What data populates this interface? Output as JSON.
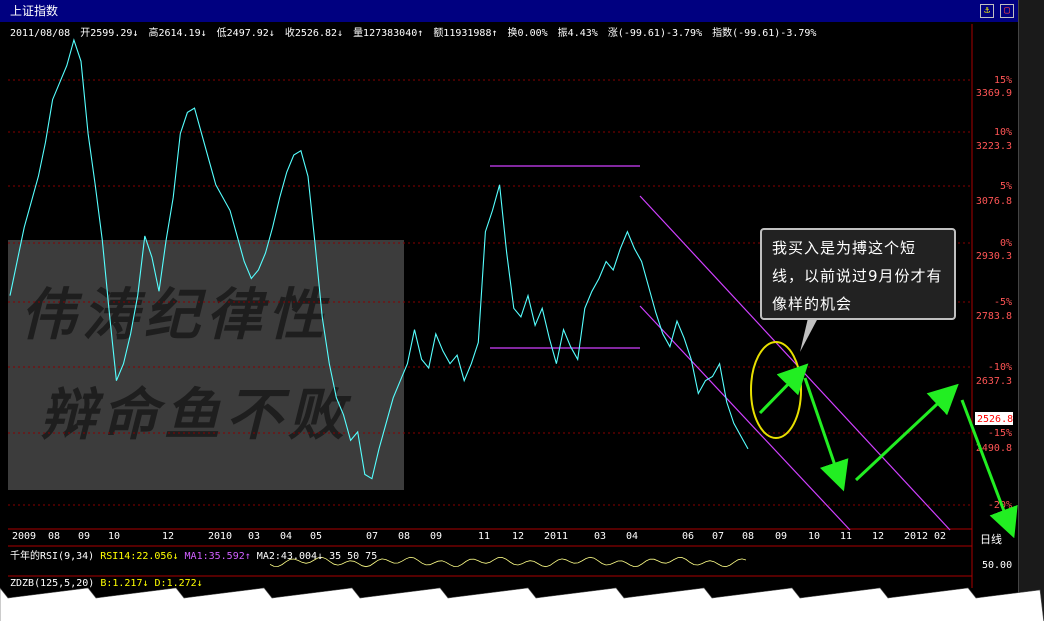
{
  "window": {
    "title": "上证指数"
  },
  "info_bar": {
    "date": "2011/08/08",
    "open": "开2599.29↓",
    "high": "高2614.19↓",
    "low": "低2497.92↓",
    "close": "收2526.82↓",
    "volume": "量127383040↑",
    "amount": "额11931988↑",
    "turnover": "换0.00%",
    "amplitude": "振4.43%",
    "change": "涨(-99.61)-3.79%",
    "index": "指数(-99.61)-3.79%"
  },
  "y_axis": {
    "pct_labels": [
      "15%",
      "10%",
      "5%",
      "0%",
      "-5%",
      "-10%",
      "-15%",
      "-20%"
    ],
    "price_labels": [
      "3369.9",
      "3223.3",
      "3076.8",
      "2930.3",
      "2783.8",
      "2637.3",
      "2490.8"
    ],
    "current_price": "2526.8"
  },
  "x_axis": {
    "months": [
      "2009",
      "08",
      "09",
      "10",
      "12",
      "2010",
      "03",
      "04",
      "05",
      "07",
      "08",
      "09",
      "11",
      "12",
      "2011",
      "03",
      "04",
      "06",
      "07",
      "08",
      "09",
      "10",
      "11",
      "12",
      "2012",
      "02"
    ],
    "period_label": "日线"
  },
  "annotation": {
    "text": "我买入是为搏这个短线，以前说过9月份才有像样的机会"
  },
  "watermark": {
    "line1": "伟涛纪律性",
    "line2": "辩命鱼不败"
  },
  "indicator_rsi": {
    "name": "千年的RSI(9,34)",
    "rsi": "RSI14:22.056↓",
    "ma1": "MA1:35.592↑",
    "ma2": "MA2:43.004↓",
    "levels": "35 50 75",
    "axis_value": "50.00"
  },
  "indicator_zdzb": {
    "name": "ZDZB(125,5,20)",
    "b": "B:1.217↓",
    "d": "D:1.272↓"
  },
  "colors": {
    "price_line": "#55ffff",
    "channel": "#d040ff",
    "arrow": "#22ee22",
    "ellipse": "#e8e000",
    "axis": "#aa0000",
    "grid": "#880000"
  },
  "chart_data": {
    "type": "line",
    "title": "上证指数",
    "y_range": [
      2440,
      3520
    ],
    "series": [
      {
        "values": [
          2920,
          3000,
          3080,
          3140,
          3200,
          3280,
          3380,
          3420,
          3460,
          3520,
          3470,
          3300,
          3180,
          3050,
          2880,
          2720,
          2760,
          2830,
          2920,
          3060,
          3010,
          2930,
          3050,
          3150,
          3300,
          3350,
          3360,
          3300,
          3240,
          3180,
          3150,
          3120,
          3060,
          3000,
          2960,
          2980,
          3020,
          3080,
          3150,
          3210,
          3250,
          3260,
          3200,
          3040,
          2870,
          2760,
          2680,
          2640,
          2580,
          2600,
          2500,
          2490,
          2560,
          2620,
          2680,
          2720,
          2760,
          2840,
          2770,
          2750,
          2830,
          2790,
          2760,
          2780,
          2720,
          2760,
          2810,
          3070,
          3120,
          3180,
          3020,
          2890,
          2870,
          2920,
          2850,
          2890,
          2820,
          2760,
          2840,
          2800,
          2770,
          2890,
          2930,
          2960,
          3000,
          2980,
          3030,
          3070,
          3030,
          3000,
          2940,
          2880,
          2830,
          2800,
          2860,
          2820,
          2770,
          2690,
          2720,
          2730,
          2760,
          2670,
          2620,
          2590,
          2560
        ]
      }
    ]
  }
}
